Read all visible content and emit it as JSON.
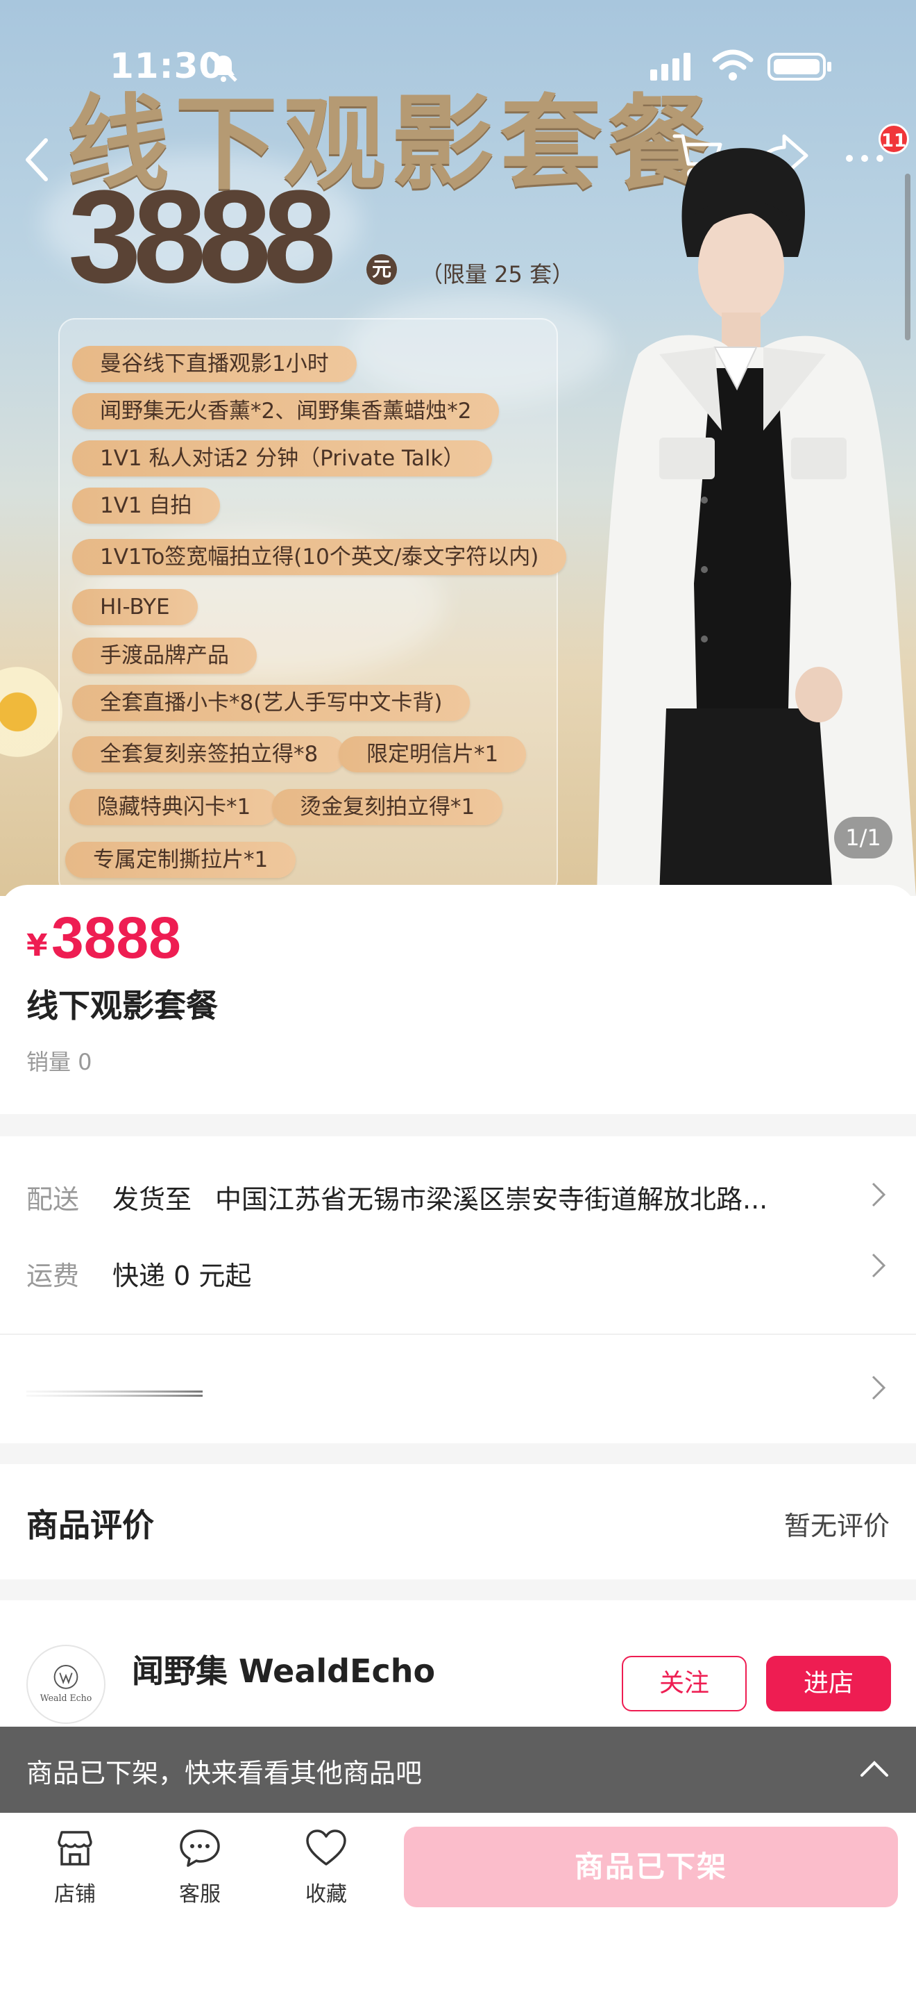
{
  "status_bar": {
    "time": "11:30",
    "mute_icon": "bell-slash-icon",
    "signal_icon": "cellular-signal-icon",
    "wifi_icon": "wifi-icon",
    "battery_icon": "battery-icon"
  },
  "nav": {
    "back_icon": "chevron-left-icon",
    "cart_icon": "cart-icon",
    "share_icon": "share-arrow-icon",
    "more_icon": "more-dots-icon",
    "badge_count": "11"
  },
  "banner": {
    "title": "线下观影套餐",
    "price": "3888",
    "yuan": "元",
    "limit": "（限量 25 套）",
    "features": [
      "曼谷线下直播观影1小时",
      "闻野集无火香薰*2、闻野集香薰蜡烛*2",
      "1V1 私人对话2 分钟（Private Talk）",
      "1V1 自拍",
      "1V1To签宽幅拍立得(10个英文/泰文字符以内)",
      "HI-BYE",
      "手渡品牌产品",
      "全套直播小卡*8(艺人手写中文卡背)",
      "全套复刻亲签拍立得*8",
      "限定明信片*1",
      "隐藏特典闪卡*1",
      "烫金复刻拍立得*1",
      "专属定制撕拉片*1"
    ],
    "page_indicator": "1/1"
  },
  "product": {
    "currency": "¥",
    "price": "3888",
    "name": "线下观影套餐",
    "sales": "销量 0"
  },
  "delivery": {
    "label": "配送",
    "ship_to": "发货至",
    "address": "中国江苏省无锡市梁溪区崇安寺街道解放北路...",
    "fee_label": "运费",
    "fee_text": "快递 0 元起"
  },
  "reviews": {
    "title": "商品评价",
    "status": "暂无评价"
  },
  "shop": {
    "name": "闻野集 WealdEcho",
    "logo_text": "Weald Echo",
    "follow_label": "关注",
    "enter_label": "进店"
  },
  "notice": {
    "text": "商品已下架，快来看看其他商品吧",
    "collapse_icon": "chevron-up-icon"
  },
  "bottom_bar": {
    "tabs": [
      {
        "label": "店铺",
        "icon": "store-icon"
      },
      {
        "label": "客服",
        "icon": "chat-bubble-icon"
      },
      {
        "label": "收藏",
        "icon": "heart-icon"
      }
    ],
    "action_label": "商品已下架"
  },
  "colors": {
    "accent": "#ee1d52",
    "disabled_button": "#fbbdcb",
    "notice_bar": "#5f5f5f",
    "pill": "#e7b987"
  }
}
